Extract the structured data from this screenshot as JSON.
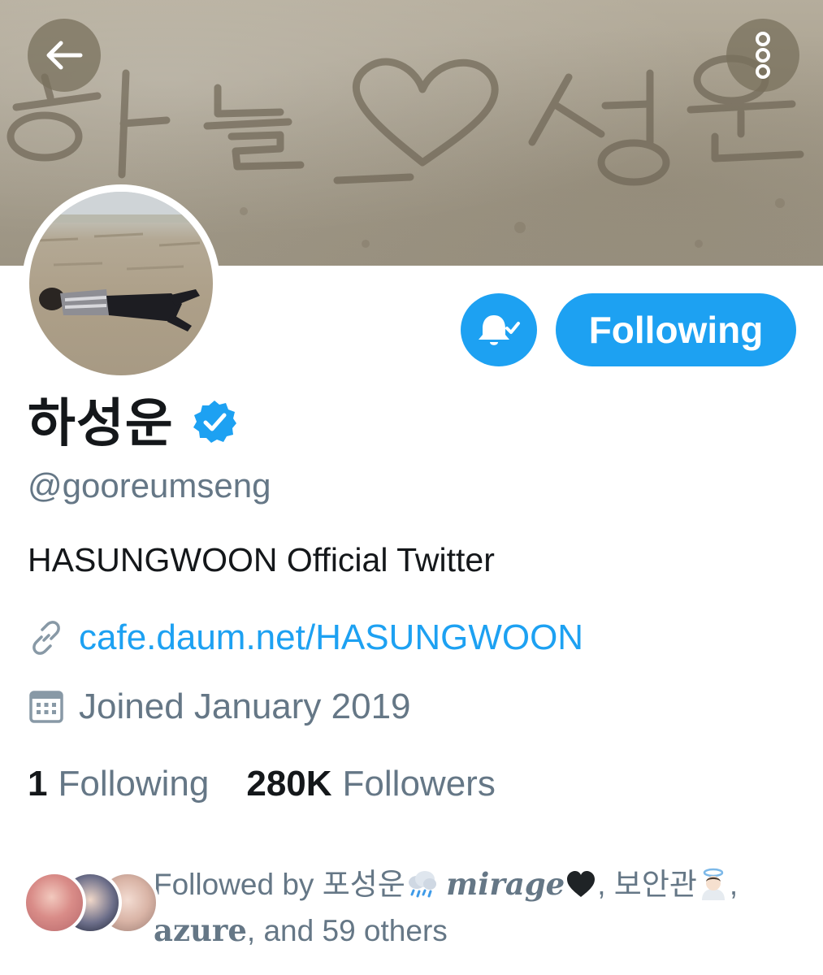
{
  "header": {
    "back_icon": "arrow-left-icon",
    "more_icon": "vertical-dots-icon"
  },
  "profile": {
    "display_name": "하성운",
    "handle": "@gooreumseng",
    "bio": "HASUNGWOON Official Twitter",
    "link": "cafe.daum.net/HASUNGWOON",
    "joined": "Joined January 2019",
    "verified": true
  },
  "actions": {
    "following_label": "Following",
    "bell_icon": "bell-check-icon"
  },
  "stats": {
    "following_count": "1",
    "following_label": "Following",
    "followers_count": "280K",
    "followers_label": "Followers"
  },
  "followed_by": {
    "prefix": "Followed by ",
    "user1": "포성운",
    "user2": "mirage",
    "sep1": ", ",
    "user3": "보안관",
    "sep2": ",",
    "user4": "azure",
    "suffix": ", and 59 others"
  },
  "colors": {
    "accent": "#1da1f2",
    "secondary_text": "#657786",
    "primary_text": "#14171a"
  }
}
